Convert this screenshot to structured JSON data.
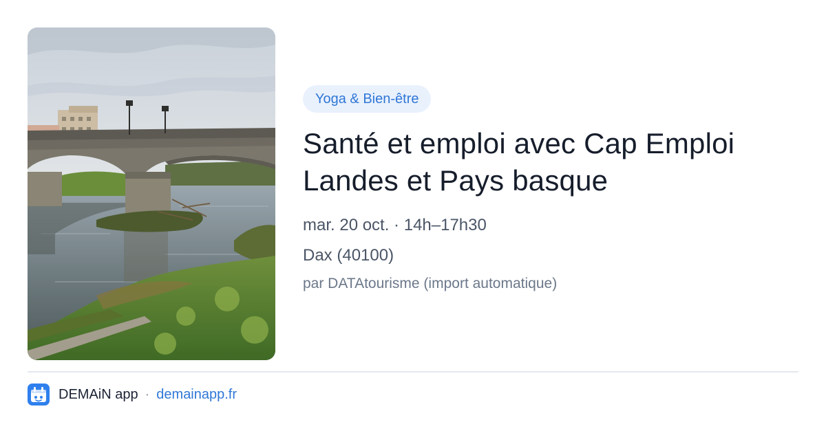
{
  "event": {
    "category": "Yoga & Bien-être",
    "title": "Santé et emploi avec Cap Emploi Landes et Pays basque",
    "date_time": "mar. 20 oct. · 14h–17h30",
    "location": "Dax (40100)",
    "source": "par DATAtourisme (import automatique)",
    "image_icon": "bridge-river-photo"
  },
  "footer": {
    "app_name": "DEMAiN app",
    "separator": "·",
    "url": "demainapp.fr",
    "app_icon": "demain-app-icon"
  },
  "colors": {
    "accent": "#2f77d6",
    "tag_background": "#e9f1fd",
    "title_text": "#161d2b",
    "meta_text": "#4a5566",
    "divider": "#e4e9ef"
  }
}
